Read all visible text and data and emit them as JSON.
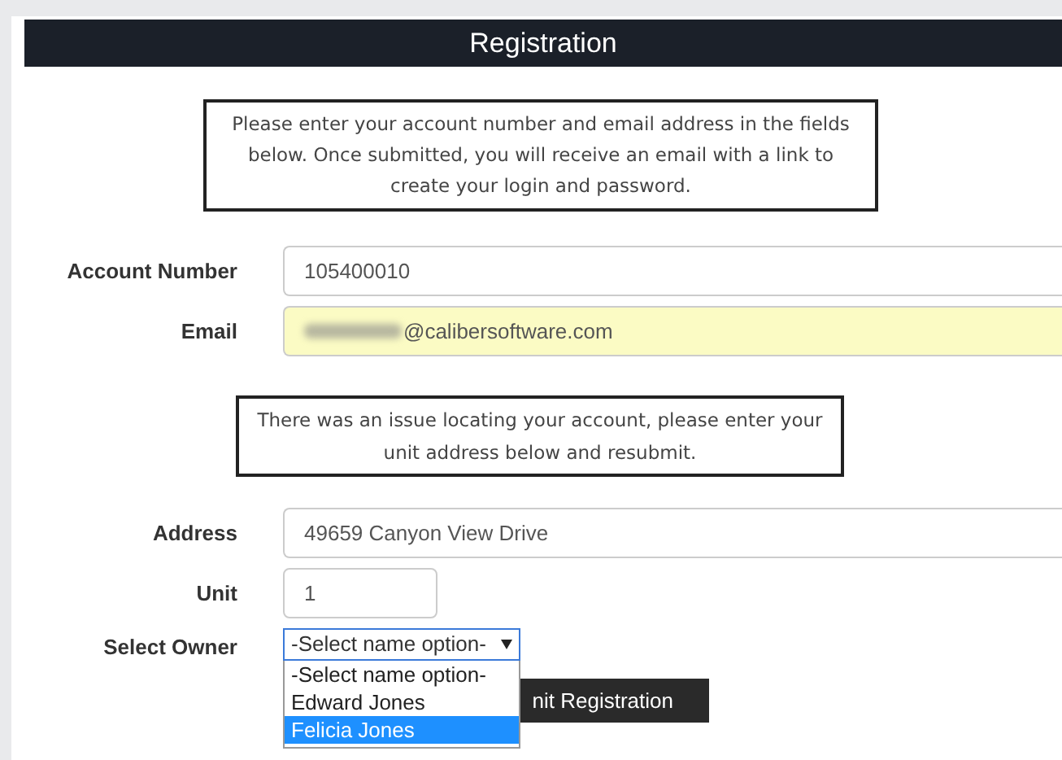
{
  "header": {
    "title": "Registration"
  },
  "intro_notice": "Please enter your account number and email address in the fields below. Once submitted, you will receive an email with a link to create your login and password.",
  "fields": [
    {
      "label": "Account Number",
      "value": "105400010",
      "highlighted": false,
      "redacted_prefix": false
    },
    {
      "label": "Email",
      "value": "@calibersoftware.com",
      "highlighted": true,
      "redacted_prefix": true
    }
  ],
  "issue_notice": "There was an issue locating your account, please enter your unit address below and resubmit.",
  "address": {
    "label": "Address",
    "value": "49659 Canyon View Drive"
  },
  "unit": {
    "label": "Unit",
    "value": "1"
  },
  "owner": {
    "label": "Select Owner",
    "value": "-Select name option-",
    "expanded": true,
    "options": [
      {
        "label": "-Select name option-",
        "highlighted": false
      },
      {
        "label": "Edward Jones",
        "highlighted": false
      },
      {
        "label": "Felicia Jones",
        "highlighted": true
      }
    ]
  },
  "submit_button": "nit Registration"
}
